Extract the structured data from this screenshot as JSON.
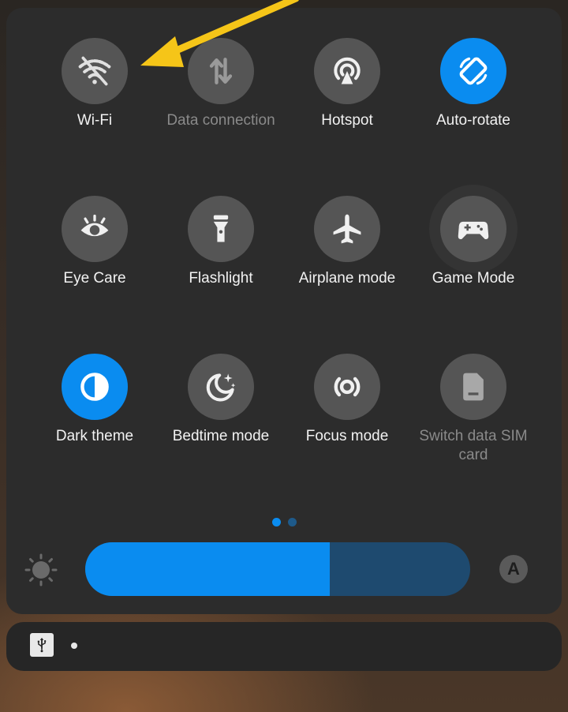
{
  "tiles": [
    {
      "label": "Wi-Fi",
      "icon": "wifi-off-icon",
      "active": false,
      "dim_label": false
    },
    {
      "label": "Data connection",
      "icon": "data-arrows-icon",
      "active": false,
      "dim_label": true
    },
    {
      "label": "Hotspot",
      "icon": "hotspot-icon",
      "active": false,
      "dim_label": false
    },
    {
      "label": "Auto-rotate",
      "icon": "rotate-icon",
      "active": true,
      "dim_label": false
    },
    {
      "label": "Eye Care",
      "icon": "eye-icon",
      "active": false,
      "dim_label": false
    },
    {
      "label": "Flashlight",
      "icon": "flashlight-icon",
      "active": false,
      "dim_label": false
    },
    {
      "label": "Airplane mode",
      "icon": "airplane-icon",
      "active": false,
      "dim_label": false
    },
    {
      "label": "Game Mode",
      "icon": "gamepad-icon",
      "active": false,
      "dim_label": false
    },
    {
      "label": "Dark theme",
      "icon": "half-circle-icon",
      "active": true,
      "dim_label": false
    },
    {
      "label": "Bedtime mode",
      "icon": "moon-stars-icon",
      "active": false,
      "dim_label": false
    },
    {
      "label": "Focus mode",
      "icon": "focus-icon",
      "active": false,
      "dim_label": false
    },
    {
      "label": "Switch data SIM card",
      "icon": "sim-card-icon",
      "active": false,
      "dim_label": true
    }
  ],
  "pager": {
    "pages": 2,
    "current": 0
  },
  "brightness": {
    "level": 0.635,
    "auto_label": "A"
  },
  "colors": {
    "accent": "#0a8cf0",
    "tile_bg": "#555555",
    "slider_track": "#1e4a6f",
    "arrow": "#f5c518"
  }
}
